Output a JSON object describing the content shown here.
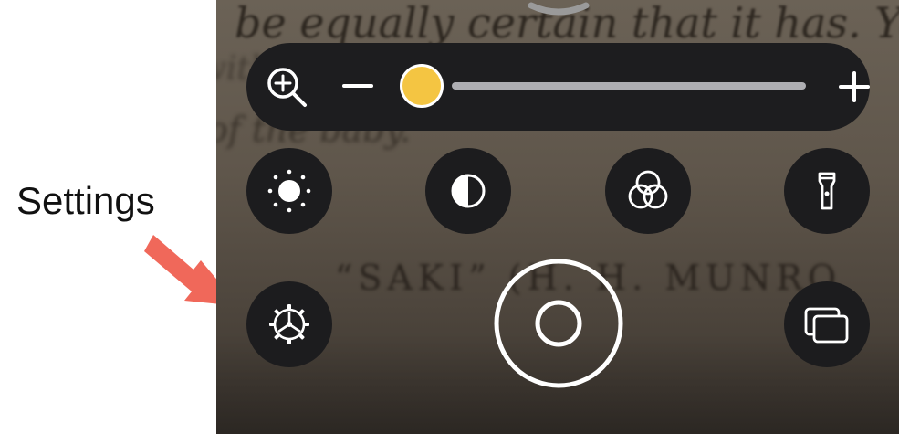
{
  "annotation": {
    "label": "Settings",
    "arrow_color": "#f0685a"
  },
  "camera_view": {
    "book_lines": [
      "be equally certain that it has. You",
      "of the baby.",
      "“SAKI” (H. H. MUNRO",
      "with"
    ]
  },
  "toolbar": {
    "zoom": {
      "level": 0.0,
      "thumb_color": "#f4c542",
      "glass_icon": "zoom-magnifier-icon",
      "minus_icon": "minus-icon",
      "plus_icon": "plus-icon"
    },
    "buttons": [
      {
        "name": "brightness",
        "icon": "sun-icon"
      },
      {
        "name": "contrast",
        "icon": "contrast-icon"
      },
      {
        "name": "filters",
        "icon": "color-filters-icon"
      },
      {
        "name": "flashlight",
        "icon": "flashlight-icon"
      },
      {
        "name": "settings",
        "icon": "gear-icon"
      },
      {
        "name": "multi-shot",
        "icon": "multi-capture-icon"
      }
    ],
    "shutter_icon": "shutter-icon"
  }
}
